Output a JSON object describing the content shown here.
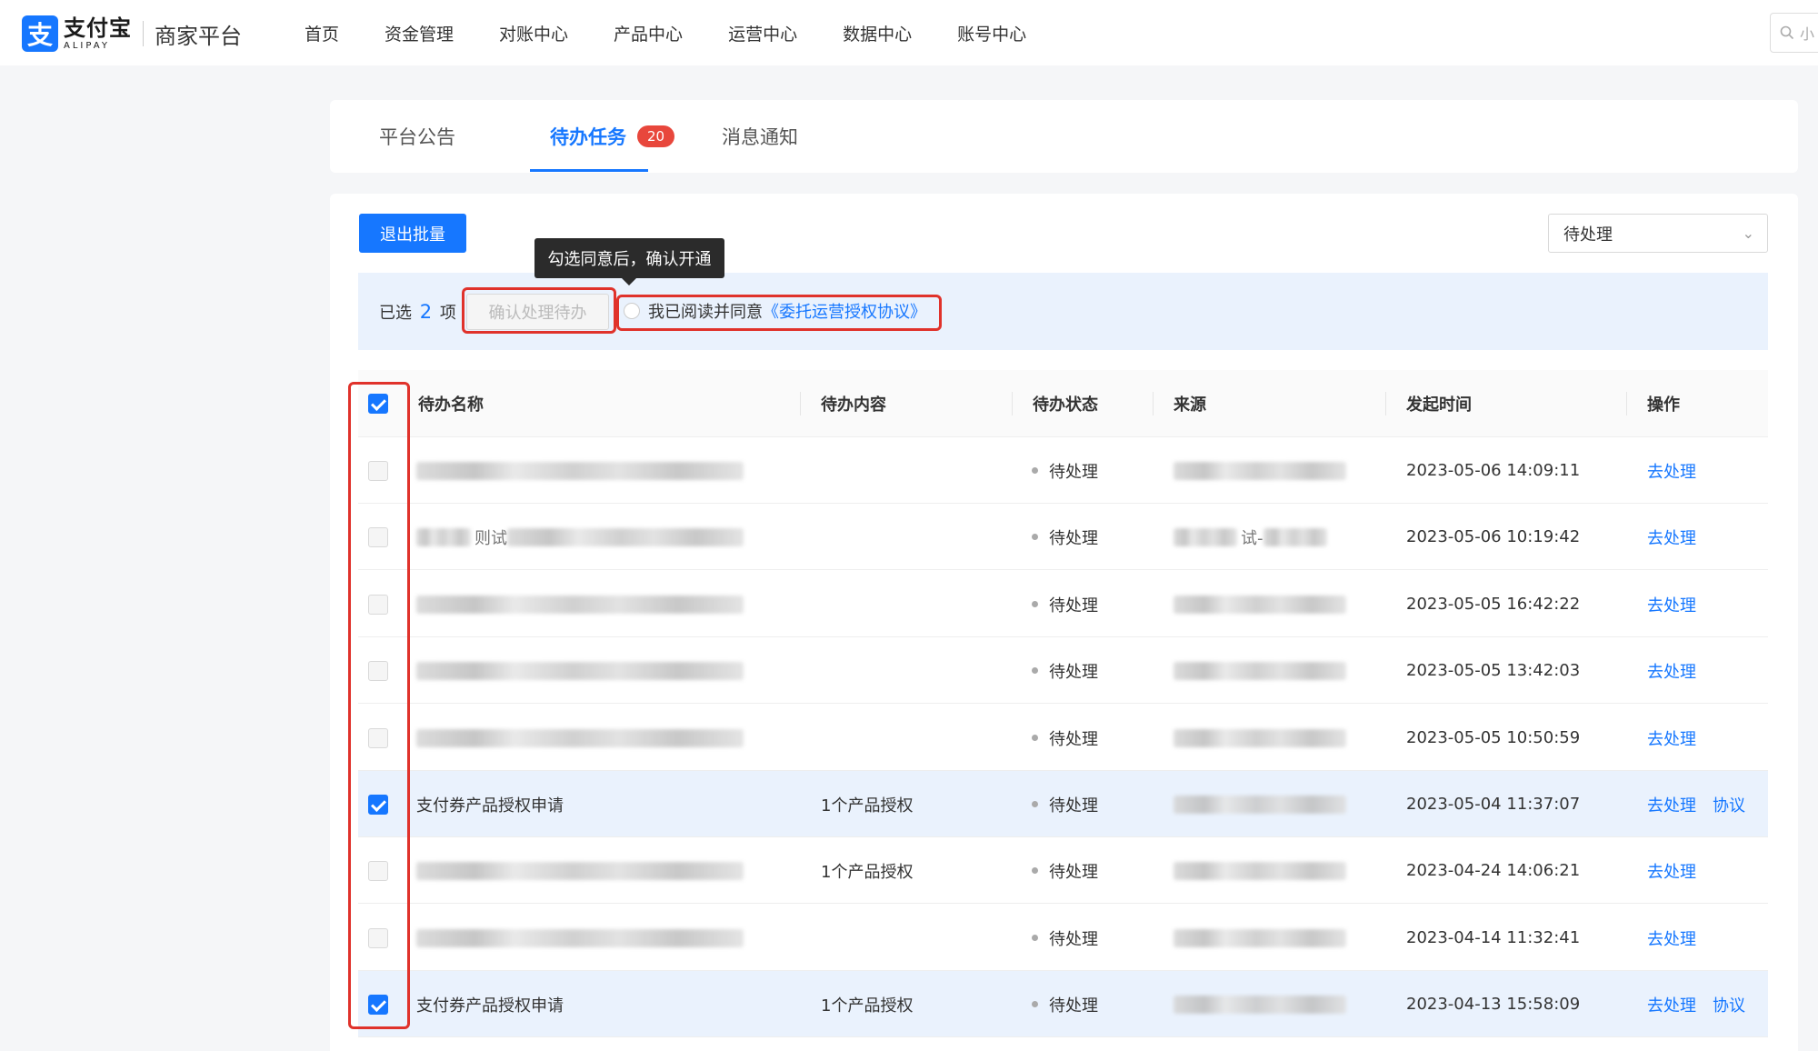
{
  "brand": {
    "mark": "支",
    "name_cn": "支付宝",
    "name_en": "ALIPAY",
    "platform": "商家平台"
  },
  "nav": {
    "items": [
      "首页",
      "资金管理",
      "对账中心",
      "产品中心",
      "运营中心",
      "数据中心",
      "账号中心"
    ],
    "search_placeholder": "小"
  },
  "tabs": [
    {
      "label": "平台公告",
      "active": false
    },
    {
      "label": "待办任务",
      "active": true,
      "badge": "20"
    },
    {
      "label": "消息通知",
      "active": false
    }
  ],
  "toolbar": {
    "exit_batch": "退出批量",
    "status_filter": "待处理"
  },
  "batch": {
    "selected_prefix": "已选",
    "selected_count": "2",
    "selected_suffix": "项",
    "confirm_button": "确认处理待办",
    "agree_text": "我已阅读并同意",
    "agreement_link": "《委托运营授权协议》",
    "tooltip": "勾选同意后，确认开通"
  },
  "table": {
    "columns": [
      "待办名称",
      "待办内容",
      "待办状态",
      "来源",
      "发起时间",
      "操作"
    ],
    "header_checked": true,
    "rows": [
      {
        "checked": false,
        "name": "",
        "name_fragment": "",
        "content": "",
        "status": "待处理",
        "source_fragment": "",
        "time": "2023-05-06 14:09:11",
        "actions": [
          "去处理"
        ]
      },
      {
        "checked": false,
        "name": "",
        "name_fragment": "则试",
        "content": "",
        "status": "待处理",
        "source_fragment": "试-",
        "time": "2023-05-06 10:19:42",
        "actions": [
          "去处理"
        ]
      },
      {
        "checked": false,
        "name": "",
        "name_fragment": "",
        "content": "",
        "status": "待处理",
        "source_fragment": "",
        "time": "2023-05-05 16:42:22",
        "actions": [
          "去处理"
        ]
      },
      {
        "checked": false,
        "name": "",
        "name_fragment": "",
        "content": "",
        "status": "待处理",
        "source_fragment": "",
        "time": "2023-05-05 13:42:03",
        "actions": [
          "去处理"
        ]
      },
      {
        "checked": false,
        "name": "",
        "name_fragment": "",
        "content": "",
        "status": "待处理",
        "source_fragment": "",
        "time": "2023-05-05 10:50:59",
        "actions": [
          "去处理"
        ]
      },
      {
        "checked": true,
        "name": "支付券产品授权申请",
        "name_fragment": "",
        "content": "1个产品授权",
        "status": "待处理",
        "source_fragment": "",
        "time": "2023-05-04 11:37:07",
        "actions": [
          "去处理",
          "协议"
        ]
      },
      {
        "checked": false,
        "name": "",
        "name_fragment": "",
        "content": "1个产品授权",
        "status": "待处理",
        "source_fragment": "",
        "time": "2023-04-24 14:06:21",
        "actions": [
          "去处理"
        ]
      },
      {
        "checked": false,
        "name": "",
        "name_fragment": "",
        "content": "",
        "status": "待处理",
        "source_fragment": "",
        "time": "2023-04-14 11:32:41",
        "actions": [
          "去处理"
        ]
      },
      {
        "checked": true,
        "name": "支付券产品授权申请",
        "name_fragment": "",
        "content": "1个产品授权",
        "status": "待处理",
        "source_fragment": "",
        "time": "2023-04-13 15:58:09",
        "actions": [
          "去处理",
          "协议"
        ]
      }
    ]
  },
  "colors": {
    "primary": "#1677ff",
    "badge": "#e8473c",
    "highlight": "#e0322b",
    "selected_row": "#eaf2fd"
  }
}
